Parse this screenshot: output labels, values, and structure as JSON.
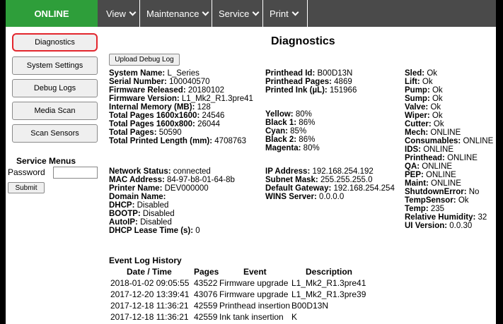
{
  "header": {
    "status": "ONLINE",
    "menus": [
      {
        "label": "View"
      },
      {
        "label": "Maintenance"
      },
      {
        "label": "Service"
      },
      {
        "label": "Print"
      }
    ]
  },
  "colors": {
    "status_bg": "#2e9e3a",
    "topbar_bg": "#4a4a4a",
    "active_outline": "#e3262d"
  },
  "sidebar": {
    "buttons": [
      "Diagnostics",
      "System Settings",
      "Debug Logs",
      "Media Scan",
      "Scan Sensors"
    ],
    "service_menus_title": "Service Menus",
    "password_label": "Password",
    "password_value": "",
    "submit_label": "Submit"
  },
  "main": {
    "title": "Diagnostics",
    "upload_label": "Upload Debug Log",
    "system": [
      {
        "k": "System Name:",
        "v": " L_Series"
      },
      {
        "k": "Serial Number:",
        "v": " 100040570"
      },
      {
        "k": "Firmware Released:",
        "v": " 20180102"
      },
      {
        "k": "Firmware Version:",
        "v": " L1_Mk2_R1.3pre41"
      },
      {
        "k": "Internal Memory (MB):",
        "v": " 128"
      },
      {
        "k": "Total Pages 1600x1600:",
        "v": " 24546"
      },
      {
        "k": "Total Pages 1600x800:",
        "v": " 26044"
      },
      {
        "k": "Total Pages:",
        "v": " 50590"
      },
      {
        "k": "Total Printed Length (mm):",
        "v": " 4708763"
      }
    ],
    "printhead": [
      {
        "k": "Printhead Id:",
        "v": " B00D13N"
      },
      {
        "k": "Printhead Pages:",
        "v": " 4869"
      },
      {
        "k": "Printed Ink (µL):",
        "v": " 151966"
      }
    ],
    "ink": [
      {
        "k": "Yellow:",
        "v": " 80%"
      },
      {
        "k": "Black 1:",
        "v": " 86%"
      },
      {
        "k": "Cyan:",
        "v": " 85%"
      },
      {
        "k": "Black 2:",
        "v": " 86%"
      },
      {
        "k": "Magenta:",
        "v": " 80%"
      }
    ],
    "network": [
      {
        "k": "Network Status:",
        "v": " connected"
      },
      {
        "k": "MAC Address:",
        "v": " 84-97-b8-01-64-8b"
      },
      {
        "k": "Printer Name:",
        "v": " DEV000000"
      },
      {
        "k": "Domain Name:",
        "v": ""
      },
      {
        "k": "DHCP:",
        "v": " Disabled"
      },
      {
        "k": "BOOTP:",
        "v": " Disabled"
      },
      {
        "k": "AutoIP:",
        "v": " Disabled"
      },
      {
        "k": "DHCP Lease Time (s):",
        "v": " 0"
      }
    ],
    "ip": [
      {
        "k": "IP Address:",
        "v": " 192.168.254.192"
      },
      {
        "k": "Subnet Mask:",
        "v": " 255.255.255.0"
      },
      {
        "k": "Default Gateway:",
        "v": " 192.168.254.254"
      },
      {
        "k": "WINS Server:",
        "v": " 0.0.0.0"
      }
    ],
    "status": [
      {
        "k": "Sled:",
        "v": " Ok"
      },
      {
        "k": "Lift:",
        "v": " Ok"
      },
      {
        "k": "Pump:",
        "v": " Ok"
      },
      {
        "k": "Sump:",
        "v": " Ok"
      },
      {
        "k": "Valve:",
        "v": " Ok"
      },
      {
        "k": "Wiper:",
        "v": " Ok"
      },
      {
        "k": "Cutter:",
        "v": " Ok"
      },
      {
        "k": "Mech:",
        "v": " ONLINE"
      },
      {
        "k": "Consumables:",
        "v": " ONLINE"
      },
      {
        "k": "IDS:",
        "v": " ONLINE"
      },
      {
        "k": "Printhead:",
        "v": " ONLINE"
      },
      {
        "k": "QA:",
        "v": " ONLINE"
      },
      {
        "k": "PEP:",
        "v": " ONLINE"
      },
      {
        "k": "Maint:",
        "v": " ONLINE"
      },
      {
        "k": "ShutdownError:",
        "v": " No"
      },
      {
        "k": "TempSensor:",
        "v": " Ok"
      },
      {
        "k": "Temp:",
        "v": " 235"
      },
      {
        "k": "Relative Humidity:",
        "v": " 32"
      },
      {
        "k": "UI Version:",
        "v": " 0.0.30"
      }
    ],
    "event_log": {
      "title": "Event Log History",
      "columns": [
        "Date / Time",
        "Pages",
        "Event",
        "Description"
      ],
      "rows": [
        [
          "2018-01-02 09:05:55",
          "43522",
          "Firmware upgrade",
          "L1_Mk2_R1.3pre41"
        ],
        [
          "2017-12-20 13:39:41",
          "43076",
          "Firmware upgrade",
          "L1_Mk2_R1.3pre39"
        ],
        [
          "2017-12-18 11:36:21",
          "42559",
          "Printhead insertion",
          "B00D13N"
        ],
        [
          "2017-12-18 11:36:21",
          "42559",
          "Ink tank insertion",
          "K"
        ]
      ]
    }
  }
}
